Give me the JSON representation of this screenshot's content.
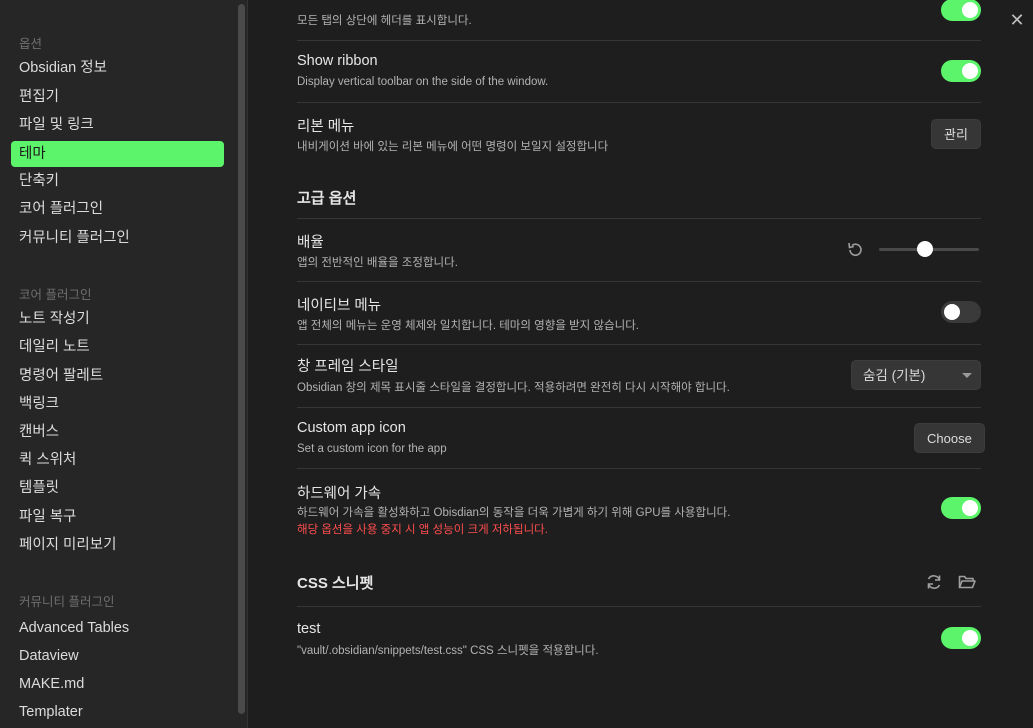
{
  "sidebar": {
    "sections": [
      {
        "label": "옵션"
      },
      {
        "label": "코어 플러그인"
      },
      {
        "label": "커뮤니티 플러그인"
      }
    ],
    "options_items": [
      "Obsidian 정보",
      "편집기",
      "파일 및 링크",
      "테마",
      "단축키",
      "코어 플러그인",
      "커뮤니티 플러그인"
    ],
    "core_items": [
      "노트 작성기",
      "데일리 노트",
      "명령어 팔레트",
      "백링크",
      "캔버스",
      "퀵 스위처",
      "템플릿",
      "파일 복구",
      "페이지 미리보기"
    ],
    "community_items": [
      "Advanced Tables",
      "Dataview",
      "MAKE.md",
      "Templater"
    ],
    "active_item": "테마"
  },
  "main": {
    "top_partial": {
      "desc": "모든 탭의 상단에 헤더를 표시합니다.",
      "toggle": "on"
    },
    "show_ribbon": {
      "title": "Show ribbon",
      "desc": "Display vertical toolbar on the side of the window.",
      "toggle": "on"
    },
    "ribbon_menu": {
      "title": "리본 메뉴",
      "desc": "내비게이션 바에 있는 리본 메뉴에 어떤 명령이 보일지 설정합니다",
      "button": "관리"
    },
    "advanced_heading": "고급 옵션",
    "zoom": {
      "title": "배율",
      "desc": "앱의 전반적인 배율을 조정합니다.",
      "slider_fraction": 0.46
    },
    "native_menu": {
      "title": "네이티브 메뉴",
      "desc": "앱 전체의 메뉴는 운영 체제와 일치합니다. 테마의 영향을 받지 않습니다.",
      "toggle": "off"
    },
    "frame_style": {
      "title": "창 프레임 스타일",
      "desc": "Obsidian 창의 제목 표시줄 스타일을 결정합니다. 적용하려면 완전히 다시 시작해야 합니다.",
      "selected": "숨김 (기본)"
    },
    "custom_icon": {
      "title": "Custom app icon",
      "desc": "Set a custom icon for the app",
      "button": "Choose"
    },
    "hw_accel": {
      "title": "하드웨어 가속",
      "desc": "하드웨어 가속을 활성화하고 Obisdian의 동작을 더욱 가볍게 하기 위해 GPU를 사용합니다.",
      "warning": "해당 옵션을 사용 중지 시 앱 성능이 크게 저하됩니다.",
      "toggle": "on"
    },
    "css_heading": "CSS 스니펫",
    "snippet": {
      "title": "test",
      "desc": "\"vault/.obsidian/snippets/test.css\" CSS 스니펫을 적용합니다.",
      "toggle": "on"
    }
  },
  "icons": {
    "close": "close-icon",
    "reset": "reset-icon",
    "reload": "reload-icon",
    "folder": "folder-icon"
  },
  "colors": {
    "accent": "#5cf46a",
    "warning": "#ff4d4f"
  }
}
